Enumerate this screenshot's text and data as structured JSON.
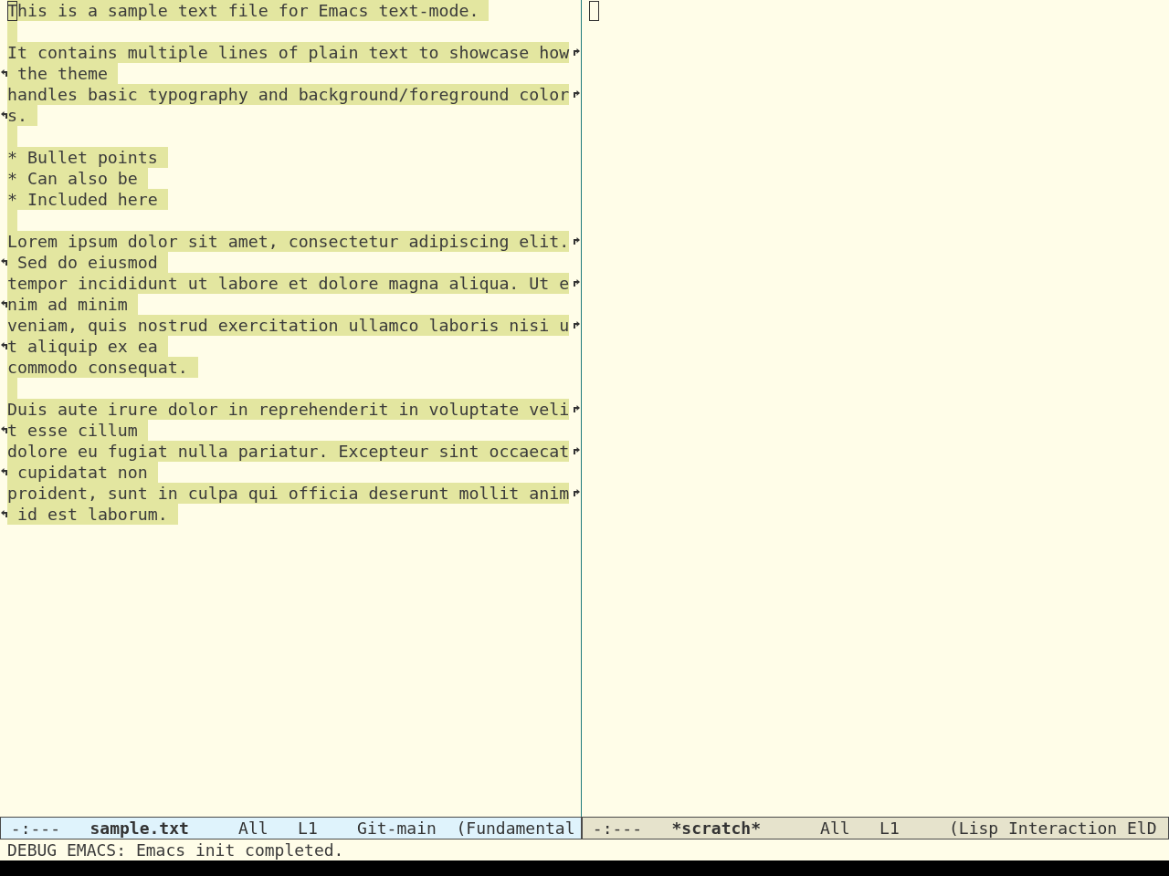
{
  "windows": [
    {
      "selected": true,
      "cursor_visible": true,
      "region_active": true,
      "lines": [
        {
          "kind": "text",
          "text": "This is a sample text file for Emacs text-mode.",
          "continued": false
        },
        {
          "kind": "blank"
        },
        {
          "kind": "text",
          "text": "It contains multiple lines of plain text to showcase how",
          "continued": true
        },
        {
          "kind": "text",
          "text": " the theme",
          "continued": false
        },
        {
          "kind": "text",
          "text": "handles basic typography and background/foreground color",
          "continued": true
        },
        {
          "kind": "text",
          "text": "s.",
          "continued": false
        },
        {
          "kind": "blank"
        },
        {
          "kind": "text",
          "text": "* Bullet points",
          "continued": false
        },
        {
          "kind": "text",
          "text": "* Can also be",
          "continued": false
        },
        {
          "kind": "text",
          "text": "* Included here",
          "continued": false
        },
        {
          "kind": "blank"
        },
        {
          "kind": "text",
          "text": "Lorem ipsum dolor sit amet, consectetur adipiscing elit.",
          "continued": true
        },
        {
          "kind": "text",
          "text": " Sed do eiusmod",
          "continued": false
        },
        {
          "kind": "text",
          "text": "tempor incididunt ut labore et dolore magna aliqua. Ut e",
          "continued": true
        },
        {
          "kind": "text",
          "text": "nim ad minim",
          "continued": false
        },
        {
          "kind": "text",
          "text": "veniam, quis nostrud exercitation ullamco laboris nisi u",
          "continued": true
        },
        {
          "kind": "text",
          "text": "t aliquip ex ea",
          "continued": false
        },
        {
          "kind": "text",
          "text": "commodo consequat.",
          "continued": false
        },
        {
          "kind": "blank"
        },
        {
          "kind": "text",
          "text": "Duis aute irure dolor in reprehenderit in voluptate veli",
          "continued": true
        },
        {
          "kind": "text",
          "text": "t esse cillum",
          "continued": false
        },
        {
          "kind": "text",
          "text": "dolore eu fugiat nulla pariatur. Excepteur sint occaecat",
          "continued": true
        },
        {
          "kind": "text",
          "text": " cupidatat non",
          "continued": false
        },
        {
          "kind": "text",
          "text": "proident, sunt in culpa qui officia deserunt mollit anim",
          "continued": true
        },
        {
          "kind": "text",
          "text": " id est laborum.",
          "continued": false
        }
      ],
      "mode_line": {
        "status": "-:---",
        "buffer_name": "sample.txt",
        "position": "All",
        "line_number": "L1",
        "vc_branch": "Git-main",
        "major_mode": "(Fundamental"
      }
    },
    {
      "selected": false,
      "cursor_visible": true,
      "mode_line": {
        "status": "-:---",
        "buffer_name": "*scratch*",
        "position": "All",
        "line_number": "L1",
        "major_mode": "(Lisp Interaction ElD"
      }
    }
  ],
  "echo_area": {
    "message": "DEBUG EMACS: Emacs init completed."
  }
}
